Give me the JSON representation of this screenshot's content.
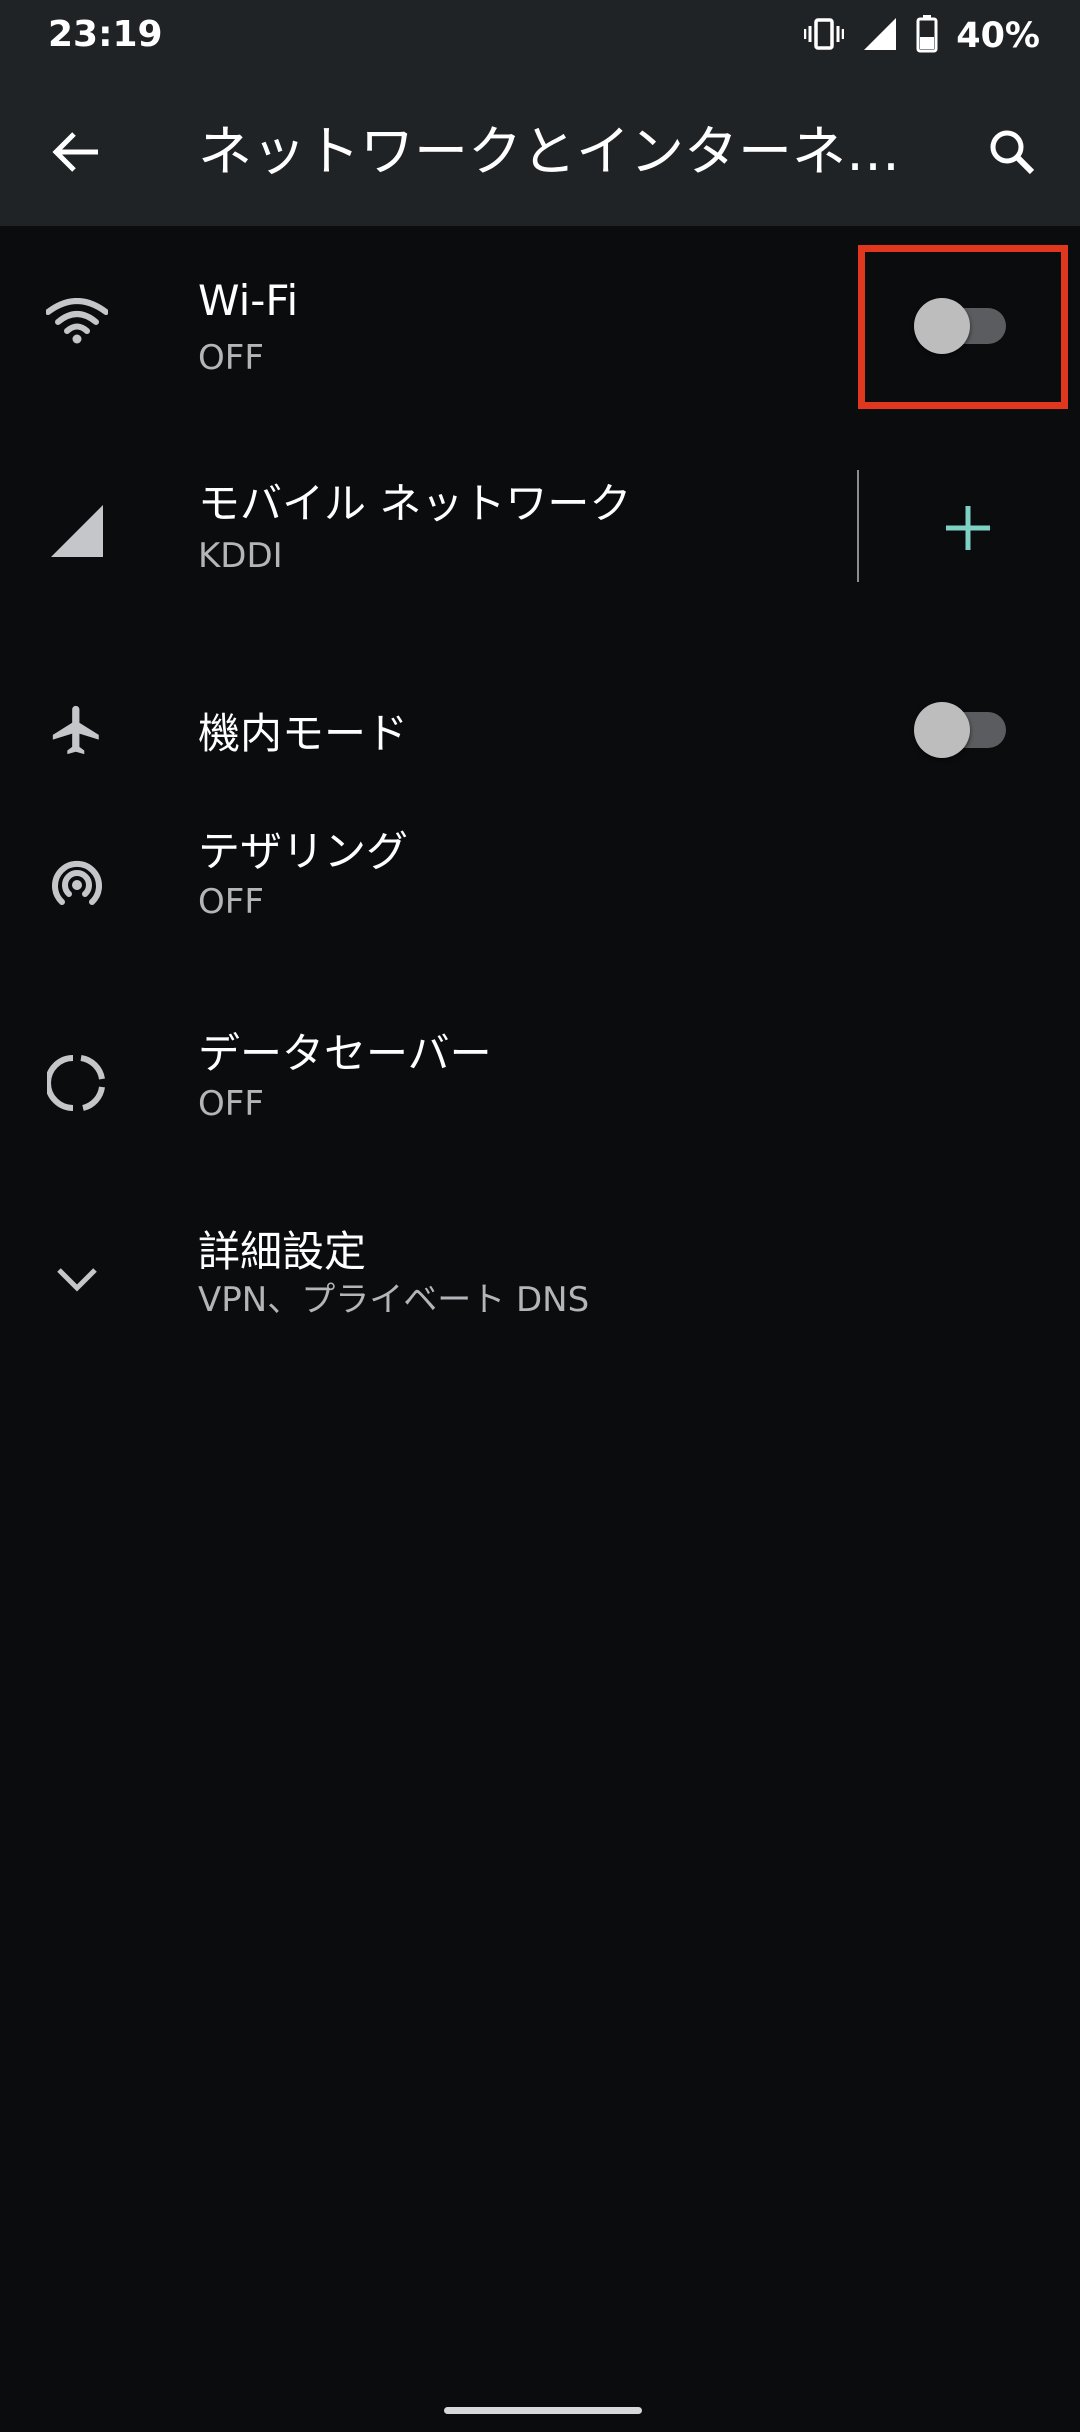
{
  "status_bar": {
    "time": "23:19",
    "battery": "40%"
  },
  "app_bar": {
    "title": "ネットワークとインターネット"
  },
  "settings": {
    "wifi": {
      "title": "Wi-Fi",
      "summary": "OFF",
      "enabled": false
    },
    "mobile": {
      "title": "モバイル ネットワーク",
      "summary": "KDDI"
    },
    "airplane": {
      "title": "機内モード",
      "enabled": false
    },
    "tethering": {
      "title": "テザリング",
      "summary": "OFF"
    },
    "data_saver": {
      "title": "データセーバー",
      "summary": "OFF"
    },
    "advanced": {
      "title": "詳細設定",
      "summary": "VPN、プライベート DNS"
    }
  },
  "colors": {
    "background": "#0b0c0e",
    "header": "#202326",
    "accent_plus": "#7dd1c5",
    "highlight_box": "#e2371f",
    "icon": "#c4c6c9"
  },
  "icons": [
    "back-arrow-icon",
    "search-icon",
    "wifi-icon",
    "cell-signal-icon",
    "airplane-icon",
    "hotspot-icon",
    "data-saver-icon",
    "chevron-down-icon",
    "plus-icon",
    "vibrate-icon",
    "battery-icon"
  ]
}
